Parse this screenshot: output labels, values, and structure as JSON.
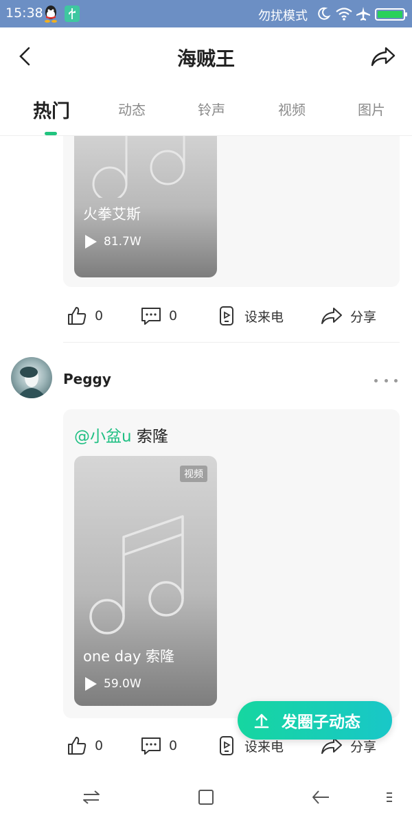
{
  "status_bar": {
    "time": "15:38",
    "mode_text": "勿扰模式",
    "icons": [
      "qq-icon",
      "usb-icon",
      "moon-icon",
      "wifi-icon",
      "airplane-icon",
      "battery-icon"
    ]
  },
  "header": {
    "title": "海贼王",
    "back_icon": "chevron-left-icon",
    "share_icon": "share-icon"
  },
  "tabs": [
    {
      "label": "热门",
      "active": true
    },
    {
      "label": "动态",
      "active": false
    },
    {
      "label": "铃声",
      "active": false
    },
    {
      "label": "视频",
      "active": false
    },
    {
      "label": "图片",
      "active": false
    }
  ],
  "posts": [
    {
      "media": {
        "title": "火拳艾斯",
        "plays": "81.7W"
      },
      "actions": {
        "like_count": "0",
        "comment_count": "0",
        "set_ringtone": "设来电",
        "share": "分享"
      }
    },
    {
      "user": {
        "name": "Peggy"
      },
      "text": {
        "mention": "@小盆u",
        "body": " 索隆"
      },
      "media": {
        "badge": "视频",
        "title": "one day 索隆",
        "plays": "59.0W"
      },
      "actions": {
        "like_count": "0",
        "comment_count": "0",
        "set_ringtone": "设来电",
        "share": "分享"
      }
    }
  ],
  "fab": {
    "label": "发圈子动态",
    "icon": "upload-arrow-icon"
  },
  "colors": {
    "accent": "#1fbf83",
    "status_bar": "#6c8fc4",
    "fab_start": "#16d6a0",
    "fab_end": "#19c7c8"
  }
}
